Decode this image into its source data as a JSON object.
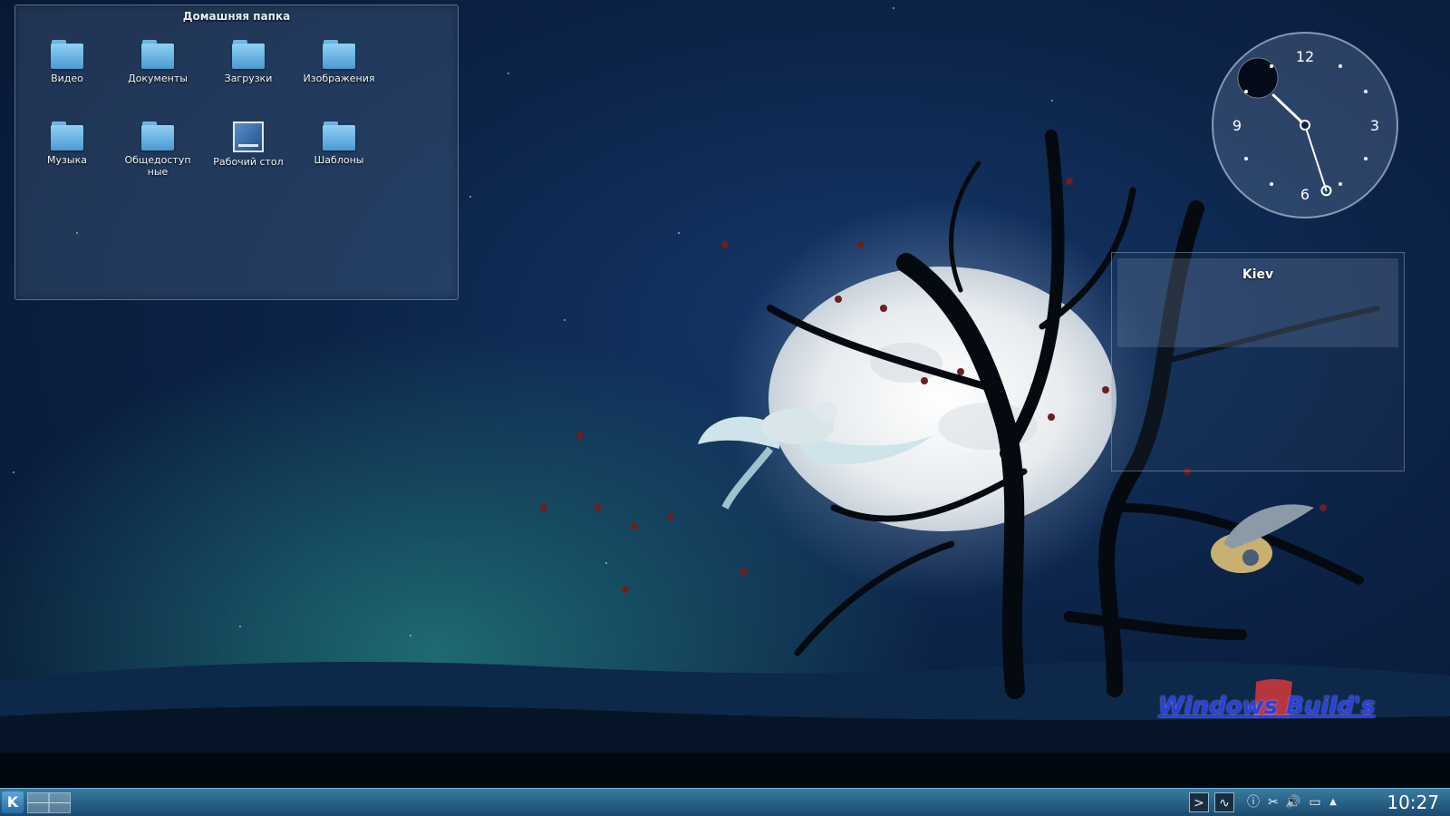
{
  "folderview": {
    "title": "Домашняя папка",
    "items": [
      {
        "label": "Видео",
        "icon": "folder-icon"
      },
      {
        "label": "Документы",
        "icon": "folder-icon"
      },
      {
        "label": "Загрузки",
        "icon": "folder-icon"
      },
      {
        "label": "Изображения",
        "icon": "folder-icon"
      },
      {
        "label": "Музыка",
        "icon": "folder-icon"
      },
      {
        "label": "Общедоступные",
        "icon": "folder-icon"
      },
      {
        "label": "Рабочий стол",
        "icon": "desktop-icon"
      },
      {
        "label": "Шаблоны",
        "icon": "folder-icon"
      }
    ]
  },
  "clock": {
    "numerals": {
      "twelve": "12",
      "three": "3",
      "six": "6",
      "nine": "9"
    },
    "hour": 10,
    "minute": 27
  },
  "weather": {
    "city": "Kiev"
  },
  "watermark": {
    "text": "Windows Build's"
  },
  "taskbar": {
    "kmenu_label": "K",
    "time": "10:27",
    "tray_icons": [
      "terminal-icon",
      "system-monitor-icon",
      "info-icon",
      "klipper-icon",
      "volume-icon",
      "device-notifier-icon",
      "expand-arrow-icon"
    ]
  },
  "colors": {
    "taskbar": "#2a6389",
    "folder": "#6fb6e4",
    "watermark": "#2a3fe0"
  }
}
